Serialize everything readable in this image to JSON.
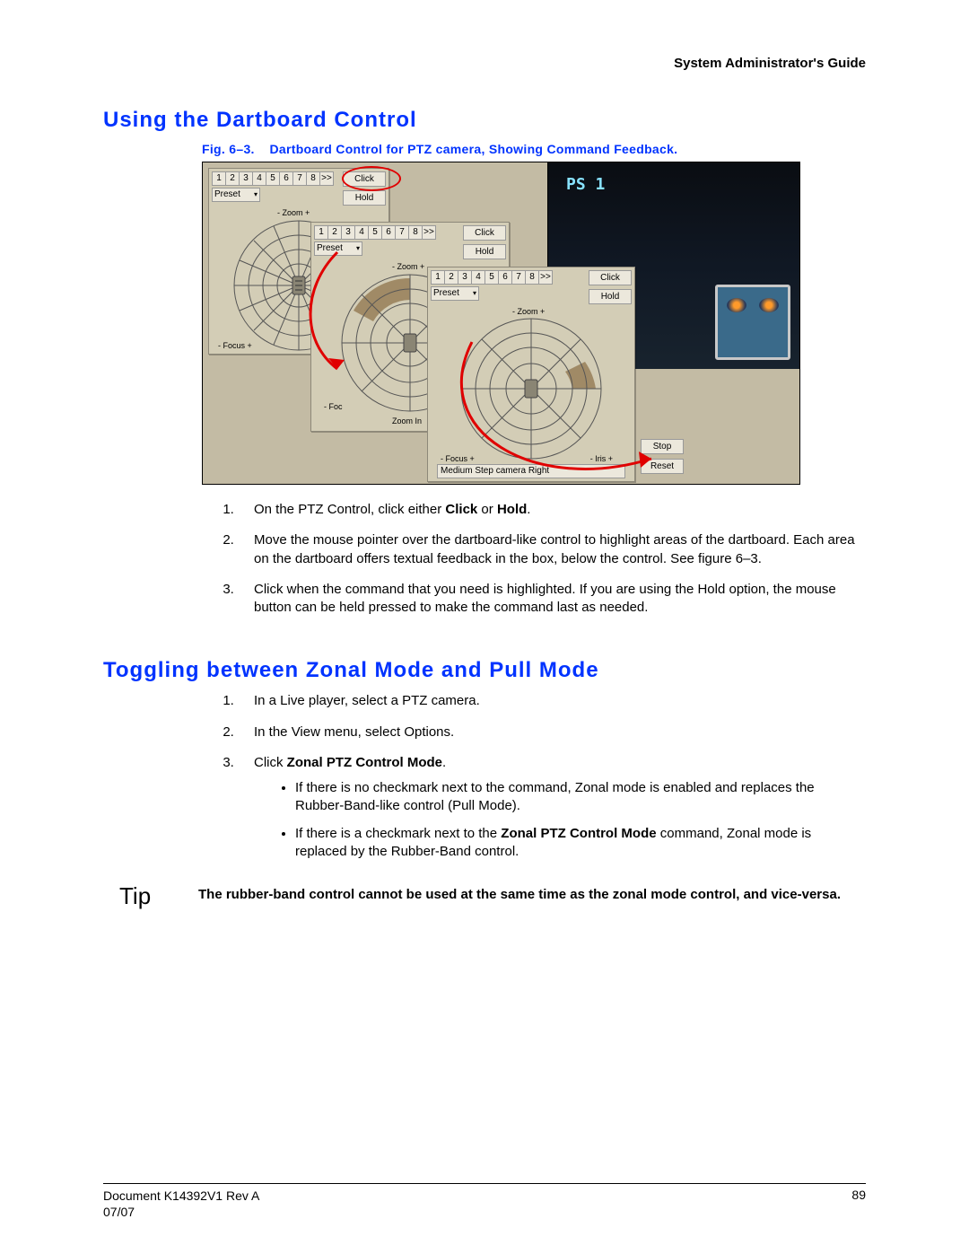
{
  "header": {
    "guide_title": "System Administrator's Guide"
  },
  "section1": {
    "title": "Using the Dartboard Control"
  },
  "figure": {
    "caption_prefix": "Fig. 6–3.",
    "caption_text": "Dartboard Control for PTZ camera, Showing Command Feedback.",
    "numbers": [
      "1",
      "2",
      "3",
      "4",
      "5",
      "6",
      "7",
      "8",
      ">>"
    ],
    "preset": "Preset",
    "click": "Click",
    "hold": "Hold",
    "stop": "Stop",
    "reset": "Reset",
    "zoom_minus": "- Zoom +",
    "zoom_in": "Zoom In",
    "focus": "- Focus +",
    "foc_short": "- Foc",
    "iris": "- Iris +",
    "status": "Medium Step camera Right",
    "ps1": "PS 1"
  },
  "inst1": [
    {
      "pre": "On the PTZ Control, click either ",
      "b1": "Click",
      "mid": " or ",
      "b2": "Hold",
      "post": "."
    },
    {
      "text": "Move the mouse pointer over the dartboard-like control to highlight areas of the dartboard. Each area on the dartboard offers textual feedback in the box, below the control. See figure 6–3."
    },
    {
      "text": "Click when the command that you need is highlighted. If you are using the Hold option, the mouse button can be held pressed to make the command last as needed."
    }
  ],
  "section2": {
    "title": "Toggling between Zonal Mode and Pull Mode"
  },
  "inst2": [
    {
      "text": "In a Live player, select a PTZ camera."
    },
    {
      "text": "In the View menu, select Options."
    },
    {
      "pre": "Click ",
      "b1": "Zonal PTZ Control Mode",
      "post": "."
    }
  ],
  "bullets": [
    {
      "text": "If there is no checkmark next to the command, Zonal mode is enabled and replaces the Rubber-Band-like control (Pull Mode)."
    },
    {
      "pre": "If there is a checkmark next to the ",
      "b1": "Zonal PTZ Control Mode",
      "post": " command, Zonal mode is replaced by the Rubber-Band control."
    }
  ],
  "tip": {
    "label": "Tip",
    "text": "The rubber-band control cannot be used at the same time as the zonal mode control, and vice-versa."
  },
  "footer": {
    "doc": "Document K14392V1 Rev A",
    "date": "07/07",
    "page": "89"
  }
}
